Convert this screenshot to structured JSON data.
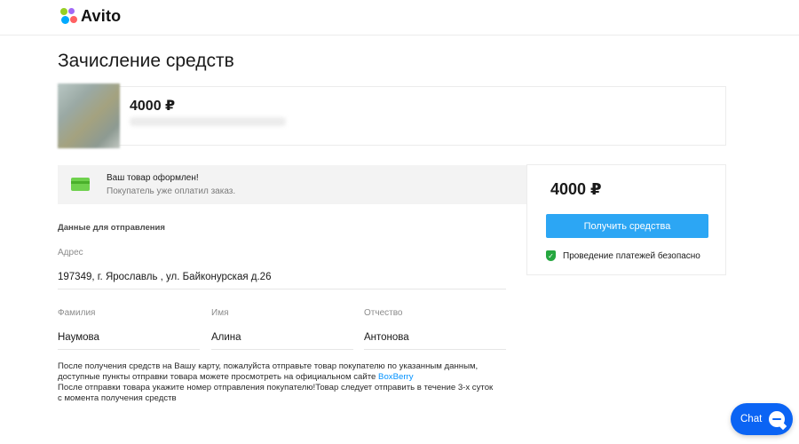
{
  "header": {
    "logo_text": "Avito"
  },
  "page": {
    "title": "Зачисление средств"
  },
  "item": {
    "price": "4000 ₽"
  },
  "notice": {
    "title": "Ваш товар оформлен!",
    "subtitle": "Покупатель уже оплатил заказ."
  },
  "shipping": {
    "section_title": "Данные для отправления",
    "address_label": "Адрес",
    "address_value": "197349, г. Ярославль , ул. Байконурская д.26",
    "last_name_label": "Фамилия",
    "last_name_value": "Наумова",
    "first_name_label": "Имя",
    "first_name_value": "Алина",
    "patronymic_label": "Отчество",
    "patronymic_value": "Антонова"
  },
  "info": {
    "line1": "После получения средств на Вашу карту, пожалуйста отправьте товар покупателю по указанным данным,",
    "line2_before": "доступные пункты отправки товара можете просмотреть на официальном сайте ",
    "line2_link": "BoxBerry",
    "line3": "После отправки товара укажите номер отправления покупателю!Товар следует отправить в течение 3-х суток",
    "line4": "с момента получения средств"
  },
  "side": {
    "price": "4000 ₽",
    "button_label": "Получить средства",
    "secure_text": "Проведение платежей безопасно"
  },
  "chat": {
    "label": "Chat"
  },
  "colors": {
    "accent": "#2ca6f4",
    "chat": "#0b64f4",
    "success": "#25a73f",
    "link": "#0091ff"
  }
}
